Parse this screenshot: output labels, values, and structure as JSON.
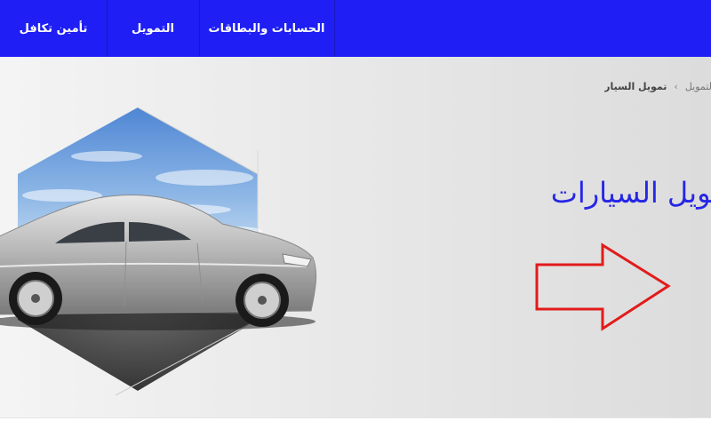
{
  "nav": {
    "items": [
      {
        "label": "الحسابات والبطاقات"
      },
      {
        "label": "التمويل"
      },
      {
        "label": "تأمين تكافل"
      }
    ]
  },
  "breadcrumb": {
    "parent": "التمويل",
    "separator": "›",
    "current": "تمويل السيارات"
  },
  "hero": {
    "title": "تمويل السيارات"
  },
  "colors": {
    "nav_bg": "#1f1ff5",
    "title": "#2626e6",
    "arrow": "#e21b1b"
  }
}
